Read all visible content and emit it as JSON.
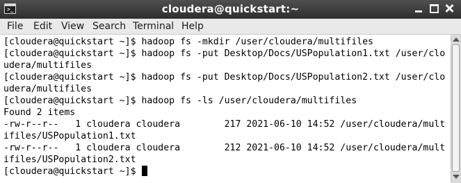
{
  "window": {
    "title": "cloudera@quickstart:~",
    "icon": "terminal-icon",
    "icon_glyph": ">_",
    "buttons": [
      "minimize-icon",
      "maximize-icon",
      "close-icon"
    ]
  },
  "menu": [
    "File",
    "Edit",
    "View",
    "Search",
    "Terminal",
    "Help"
  ],
  "terminal": {
    "lines": [
      "[cloudera@quickstart ~]$ hadoop fs -mkdir /user/cloudera/multifiles",
      "[cloudera@quickstart ~]$ hadoop fs -put Desktop/Docs/USPopulation1.txt /user/clo",
      "udera/multifiles",
      "[cloudera@quickstart ~]$ hadoop fs -put Desktop/Docs/USPopulation2.txt /user/clo",
      "udera/multifiles",
      "[cloudera@quickstart ~]$ hadoop fs -ls /user/cloudera/multifiles",
      "Found 2 items",
      "-rw-r--r--   1 cloudera cloudera        217 2021-06-10 14:52 /user/cloudera/mult",
      "ifiles/USPopulation1.txt",
      "-rw-r--r--   1 cloudera cloudera        212 2021-06-10 14:52 /user/cloudera/mult",
      "ifiles/USPopulation2.txt",
      "[cloudera@quickstart ~]$ "
    ]
  },
  "colors": {
    "titlebar": "#3a3a3a",
    "menubar": "#e9e9e9",
    "terminal_bg": "#ffffff",
    "terminal_fg": "#000000"
  }
}
